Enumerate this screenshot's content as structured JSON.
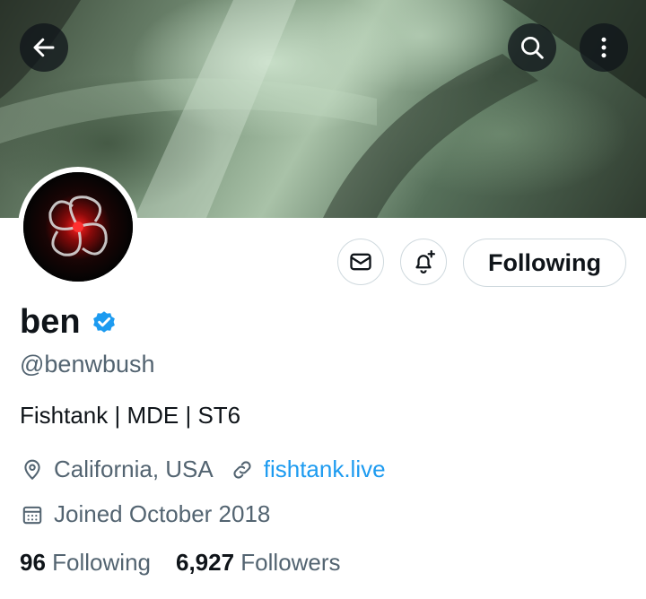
{
  "profile": {
    "name": "ben",
    "handle": "@benwbush",
    "bio": "Fishtank | MDE | ST6",
    "location": "California, USA",
    "website": "fishtank.live",
    "joined": "Joined October 2018",
    "following_count": "96",
    "following_label": "Following",
    "followers_count": "6,927",
    "followers_label": "Followers"
  },
  "actions": {
    "following_button": "Following"
  },
  "icons": {
    "back": "back-arrow-icon",
    "search": "search-icon",
    "more": "more-vertical-icon",
    "message": "envelope-icon",
    "notify": "bell-plus-icon",
    "verified": "verified-badge-icon",
    "location": "location-pin-icon",
    "link": "link-icon",
    "calendar": "calendar-icon"
  },
  "colors": {
    "accent": "#1d9bf0",
    "text": "#0f1419",
    "secondary": "#536471",
    "border": "#cfd9de"
  }
}
